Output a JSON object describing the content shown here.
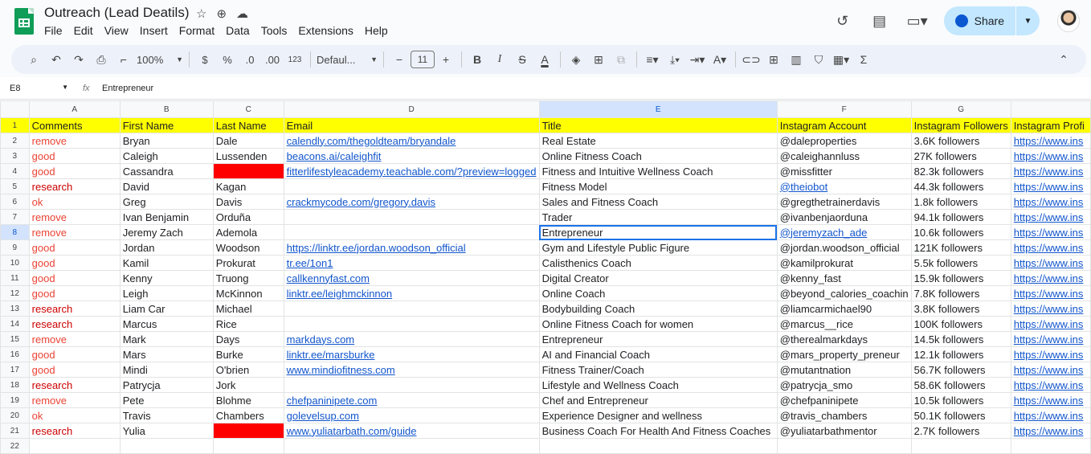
{
  "app": {
    "doc_title": "Outreach (Lead Deatils)",
    "menu": [
      "File",
      "Edit",
      "View",
      "Insert",
      "Format",
      "Data",
      "Tools",
      "Extensions",
      "Help"
    ],
    "share_label": "Share"
  },
  "toolbar": {
    "zoom": "100%",
    "currency": "$",
    "percent": "%",
    "dec_decrease": ".0",
    "dec_increase": ".00",
    "number_format": "123",
    "font": "Defaul...",
    "font_size": "11"
  },
  "formula_bar": {
    "name_box": "E8",
    "fx": "fx",
    "value": "Entrepreneur"
  },
  "sheet": {
    "columns": [
      "A",
      "B",
      "C",
      "D",
      "E",
      "F",
      "G",
      ""
    ],
    "selected_col": "E",
    "rows": [
      {
        "n": "1",
        "cells": [
          "Comments",
          "First Name",
          "Last Name",
          "Email",
          "Title",
          "Instagram Account",
          "Instagram Followers",
          "Instagram Profi"
        ]
      },
      {
        "n": "2",
        "cells": [
          "remove",
          "Bryan",
          "Dale",
          "calendly.com/thegoldteam/bryandale",
          "Real Estate",
          "@daleproperties",
          "3.6K followers",
          "https://www.ins"
        ]
      },
      {
        "n": "3",
        "cells": [
          "good",
          "Caleigh",
          "Lussenden",
          "beacons.ai/caleighfit",
          "Online Fitness Coach",
          "@caleighannluss",
          "27K followers",
          "https://www.ins"
        ]
      },
      {
        "n": "4",
        "cells": [
          "good",
          "Cassandra",
          "",
          "fitterlifestyleacademy.teachable.com/?preview=logged",
          "Fitness and Intuitive Wellness Coach",
          "@missfitter",
          "82.3k followers",
          "https://www.ins"
        ]
      },
      {
        "n": "5",
        "cells": [
          "research",
          "David",
          "Kagan",
          "",
          "Fitness Model",
          "@theiobot",
          "44.3k followers",
          "https://www.ins"
        ]
      },
      {
        "n": "6",
        "cells": [
          "ok",
          "Greg",
          "Davis",
          "crackmycode.com/gregory.davis",
          "Sales and Fitness Coach",
          "@gregthetrainerdavis",
          "1.8k followers",
          "https://www.ins"
        ]
      },
      {
        "n": "7",
        "cells": [
          "remove",
          "Ivan Benjamin",
          "Orduña",
          "",
          "Trader",
          "@ivanbenjaorduna",
          "94.1k followers",
          "https://www.ins"
        ]
      },
      {
        "n": "8",
        "cells": [
          "remove",
          "Jeremy Zach",
          "Ademola",
          "",
          "Entrepreneur",
          "@jeremyzach_ade",
          "10.6k followers",
          "https://www.ins"
        ]
      },
      {
        "n": "9",
        "cells": [
          "good",
          "Jordan",
          "Woodson",
          "https://linktr.ee/jordan.woodson_official",
          "Gym and Lifestyle Public Figure",
          "@jordan.woodson_official",
          "121K followers",
          "https://www.ins"
        ]
      },
      {
        "n": "10",
        "cells": [
          "good",
          "Kamil",
          "Prokurat",
          "tr.ee/1on1",
          "Calisthenics Coach",
          "@kamilprokurat",
          "5.5k followers",
          "https://www.ins"
        ]
      },
      {
        "n": "11",
        "cells": [
          "good",
          "Kenny",
          "Truong",
          "callkennyfast.com",
          "Digital Creator",
          "@kenny_fast",
          "15.9k followers",
          "https://www.ins"
        ]
      },
      {
        "n": "12",
        "cells": [
          "good",
          "Leigh",
          "McKinnon",
          "linktr.ee/leighmckinnon",
          "Online Coach",
          "@beyond_calories_coachin",
          "7.8K followers",
          "https://www.ins"
        ]
      },
      {
        "n": "13",
        "cells": [
          "research",
          "Liam Car",
          "Michael",
          "",
          "Bodybuilding Coach",
          "@liamcarmichael90",
          "3.8K followers",
          "https://www.ins"
        ]
      },
      {
        "n": "14",
        "cells": [
          "research",
          "Marcus",
          "Rice",
          "",
          "Online Fitness Coach for women",
          "@marcus__rice",
          "100K followers",
          "https://www.ins"
        ]
      },
      {
        "n": "15",
        "cells": [
          "remove",
          "Mark",
          "Days",
          "markdays.com",
          "Entrepreneur",
          "@therealmarkdays",
          "14.5k followers",
          "https://www.ins"
        ]
      },
      {
        "n": "16",
        "cells": [
          "good",
          "Mars",
          "Burke",
          "linktr.ee/marsburke",
          "AI and Financial Coach",
          "@mars_property_preneur",
          "12.1k followers",
          "https://www.ins"
        ]
      },
      {
        "n": "17",
        "cells": [
          "good",
          "Mindi",
          "O'brien",
          "www.mindiofitness.com",
          "Fitness Trainer/Coach",
          "@mutantnation",
          "56.7K followers",
          "https://www.ins"
        ]
      },
      {
        "n": "18",
        "cells": [
          "research",
          "Patrycja",
          "Jork",
          "",
          "Lifestyle and Wellness Coach",
          "@patrycja_smo",
          "58.6K followers",
          "https://www.ins"
        ]
      },
      {
        "n": "19",
        "cells": [
          "remove",
          "Pete",
          "Blohme",
          "chefpaninipete.com",
          "Chef and Entrepreneur",
          "@chefpaninipete",
          "10.5k followers",
          "https://www.ins"
        ]
      },
      {
        "n": "20",
        "cells": [
          "ok",
          "Travis",
          "Chambers",
          "golevelsup.com",
          "Experience Designer and wellness",
          "@travis_chambers",
          "50.1K followers",
          "https://www.ins"
        ]
      },
      {
        "n": "21",
        "cells": [
          "research",
          "Yulia",
          "",
          "www.yuliatarbath.com/guide",
          "Business Coach For Health And Fitness Coaches",
          "@yuliatarbathmentor",
          "2.7K followers",
          "https://www.ins"
        ]
      },
      {
        "n": "22",
        "cells": [
          "",
          "",
          "",
          "",
          "",
          "",
          "",
          ""
        ]
      }
    ]
  }
}
